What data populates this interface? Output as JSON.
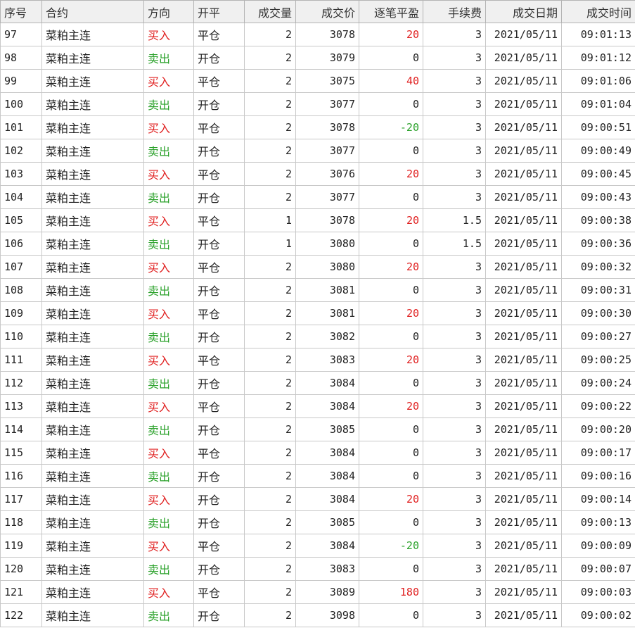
{
  "colors": {
    "buy": "#e02020",
    "sell": "#2aa12a",
    "profit": "#e02020",
    "loss": "#2aa12a",
    "header_bg": "#f0f0f0",
    "grid": "#c8c8c8"
  },
  "columns": [
    "序号",
    "合约",
    "方向",
    "开平",
    "成交量",
    "成交价",
    "逐笔平盈",
    "手续费",
    "成交日期",
    "成交时间"
  ],
  "rows": [
    [
      "97",
      "菜粕主连",
      "买入",
      "平仓",
      "2",
      "3078",
      "20",
      "3",
      "2021/05/11",
      "09:01:13"
    ],
    [
      "98",
      "菜粕主连",
      "卖出",
      "开仓",
      "2",
      "3079",
      "0",
      "3",
      "2021/05/11",
      "09:01:12"
    ],
    [
      "99",
      "菜粕主连",
      "买入",
      "平仓",
      "2",
      "3075",
      "40",
      "3",
      "2021/05/11",
      "09:01:06"
    ],
    [
      "100",
      "菜粕主连",
      "卖出",
      "开仓",
      "2",
      "3077",
      "0",
      "3",
      "2021/05/11",
      "09:01:04"
    ],
    [
      "101",
      "菜粕主连",
      "买入",
      "平仓",
      "2",
      "3078",
      "-20",
      "3",
      "2021/05/11",
      "09:00:51"
    ],
    [
      "102",
      "菜粕主连",
      "卖出",
      "开仓",
      "2",
      "3077",
      "0",
      "3",
      "2021/05/11",
      "09:00:49"
    ],
    [
      "103",
      "菜粕主连",
      "买入",
      "平仓",
      "2",
      "3076",
      "20",
      "3",
      "2021/05/11",
      "09:00:45"
    ],
    [
      "104",
      "菜粕主连",
      "卖出",
      "开仓",
      "2",
      "3077",
      "0",
      "3",
      "2021/05/11",
      "09:00:43"
    ],
    [
      "105",
      "菜粕主连",
      "买入",
      "平仓",
      "1",
      "3078",
      "20",
      "1.5",
      "2021/05/11",
      "09:00:38"
    ],
    [
      "106",
      "菜粕主连",
      "卖出",
      "开仓",
      "1",
      "3080",
      "0",
      "1.5",
      "2021/05/11",
      "09:00:36"
    ],
    [
      "107",
      "菜粕主连",
      "买入",
      "平仓",
      "2",
      "3080",
      "20",
      "3",
      "2021/05/11",
      "09:00:32"
    ],
    [
      "108",
      "菜粕主连",
      "卖出",
      "开仓",
      "2",
      "3081",
      "0",
      "3",
      "2021/05/11",
      "09:00:31"
    ],
    [
      "109",
      "菜粕主连",
      "买入",
      "平仓",
      "2",
      "3081",
      "20",
      "3",
      "2021/05/11",
      "09:00:30"
    ],
    [
      "110",
      "菜粕主连",
      "卖出",
      "开仓",
      "2",
      "3082",
      "0",
      "3",
      "2021/05/11",
      "09:00:27"
    ],
    [
      "111",
      "菜粕主连",
      "买入",
      "平仓",
      "2",
      "3083",
      "20",
      "3",
      "2021/05/11",
      "09:00:25"
    ],
    [
      "112",
      "菜粕主连",
      "卖出",
      "开仓",
      "2",
      "3084",
      "0",
      "3",
      "2021/05/11",
      "09:00:24"
    ],
    [
      "113",
      "菜粕主连",
      "买入",
      "平仓",
      "2",
      "3084",
      "20",
      "3",
      "2021/05/11",
      "09:00:22"
    ],
    [
      "114",
      "菜粕主连",
      "卖出",
      "开仓",
      "2",
      "3085",
      "0",
      "3",
      "2021/05/11",
      "09:00:20"
    ],
    [
      "115",
      "菜粕主连",
      "买入",
      "平仓",
      "2",
      "3084",
      "0",
      "3",
      "2021/05/11",
      "09:00:17"
    ],
    [
      "116",
      "菜粕主连",
      "卖出",
      "开仓",
      "2",
      "3084",
      "0",
      "3",
      "2021/05/11",
      "09:00:16"
    ],
    [
      "117",
      "菜粕主连",
      "买入",
      "开仓",
      "2",
      "3084",
      "20",
      "3",
      "2021/05/11",
      "09:00:14"
    ],
    [
      "118",
      "菜粕主连",
      "卖出",
      "开仓",
      "2",
      "3085",
      "0",
      "3",
      "2021/05/11",
      "09:00:13"
    ],
    [
      "119",
      "菜粕主连",
      "买入",
      "平仓",
      "2",
      "3084",
      "-20",
      "3",
      "2021/05/11",
      "09:00:09"
    ],
    [
      "120",
      "菜粕主连",
      "卖出",
      "开仓",
      "2",
      "3083",
      "0",
      "3",
      "2021/05/11",
      "09:00:07"
    ],
    [
      "121",
      "菜粕主连",
      "买入",
      "平仓",
      "2",
      "3089",
      "180",
      "3",
      "2021/05/11",
      "09:00:03"
    ],
    [
      "122",
      "菜粕主连",
      "卖出",
      "开仓",
      "2",
      "3098",
      "0",
      "3",
      "2021/05/11",
      "09:00:02"
    ]
  ]
}
